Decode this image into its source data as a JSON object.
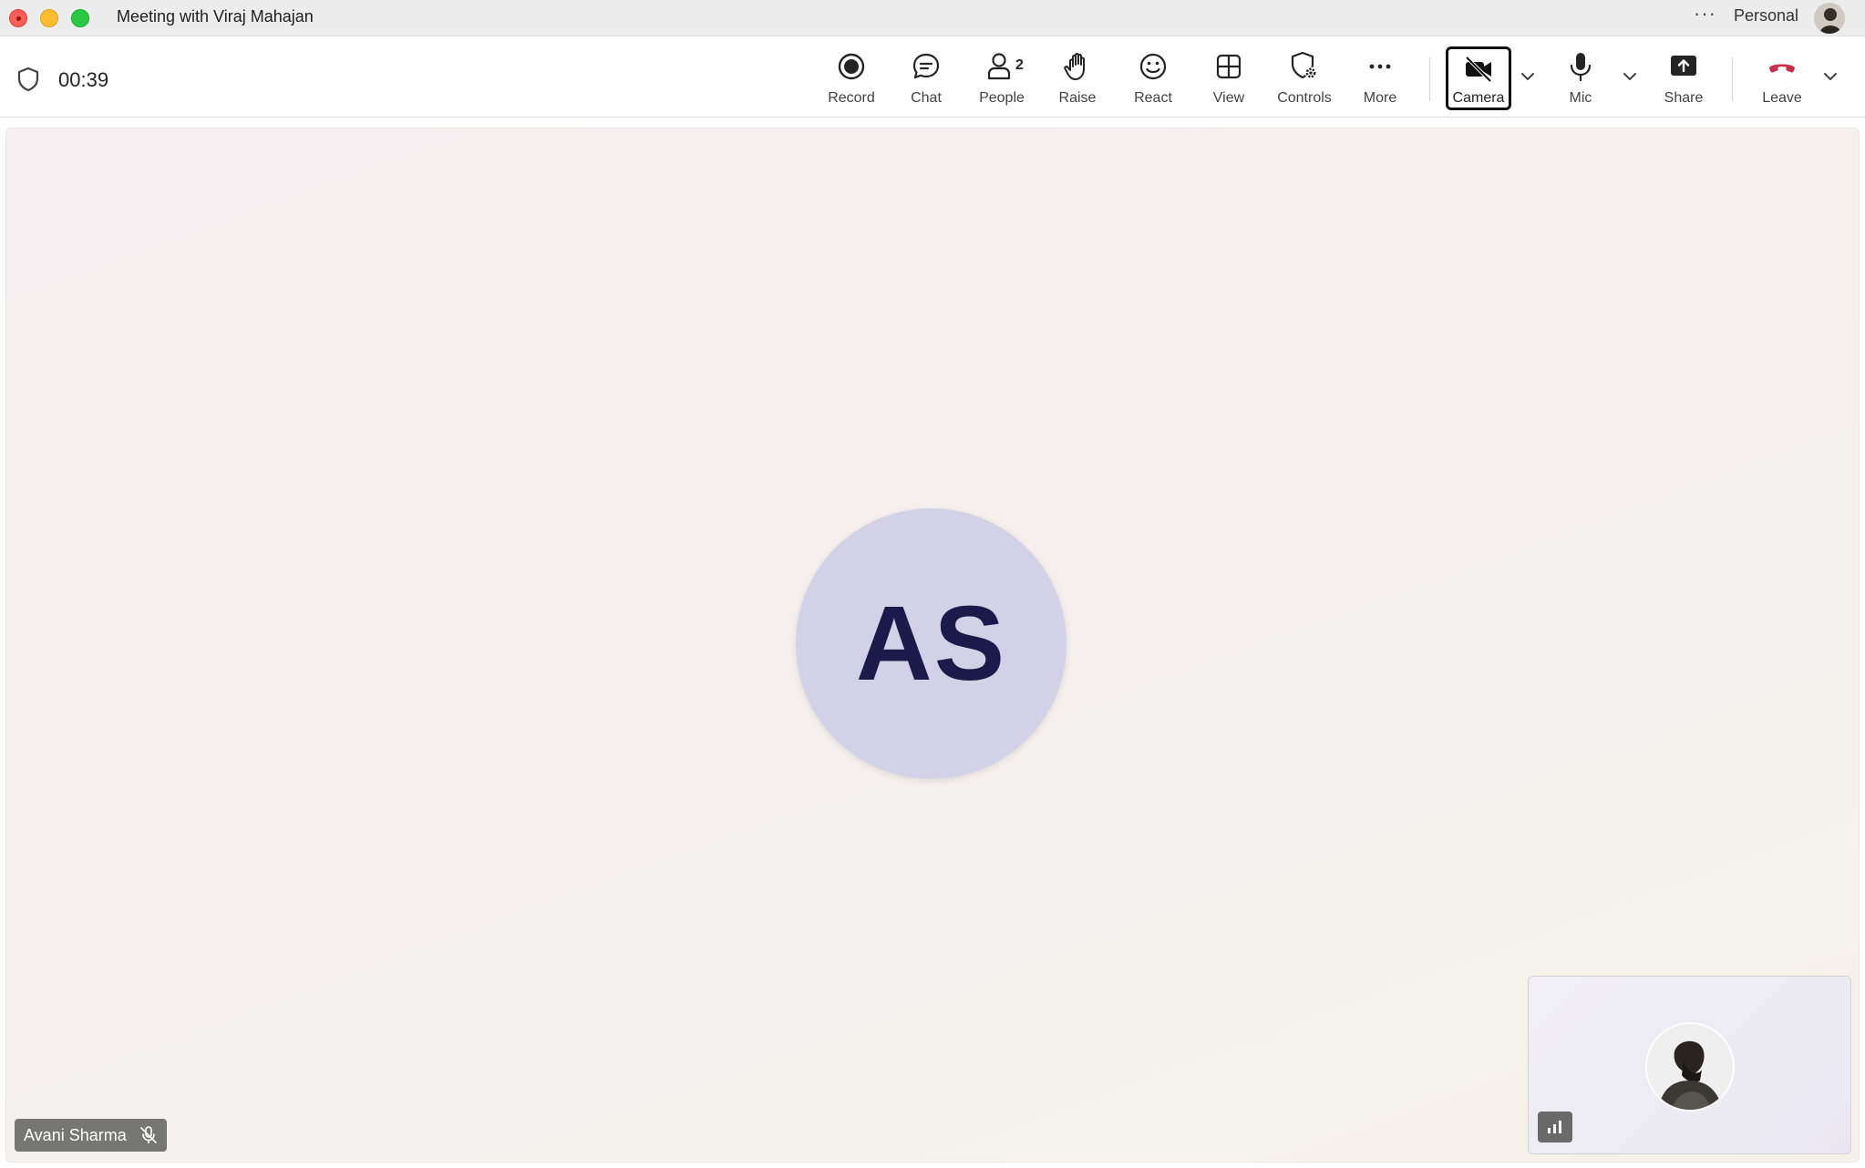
{
  "window": {
    "title": "Meeting with Viraj Mahajan",
    "more_label": "···",
    "account_label": "Personal"
  },
  "toolbar": {
    "timer": "00:39",
    "people_count": "2",
    "buttons": [
      {
        "id": "record",
        "label": "Record",
        "icon": "record-icon"
      },
      {
        "id": "chat",
        "label": "Chat",
        "icon": "chat-icon"
      },
      {
        "id": "people",
        "label": "People",
        "icon": "people-icon"
      },
      {
        "id": "raise",
        "label": "Raise",
        "icon": "raise-hand-icon"
      },
      {
        "id": "react",
        "label": "React",
        "icon": "smiley-icon"
      },
      {
        "id": "view",
        "label": "View",
        "icon": "grid-icon"
      },
      {
        "id": "controls",
        "label": "Controls",
        "icon": "shield-gear-icon"
      },
      {
        "id": "more",
        "label": "More",
        "icon": "more-icon"
      },
      {
        "id": "camera",
        "label": "Camera",
        "icon": "camera-off-icon"
      },
      {
        "id": "mic",
        "label": "Mic",
        "icon": "mic-icon"
      },
      {
        "id": "share",
        "label": "Share",
        "icon": "share-icon"
      },
      {
        "id": "leave",
        "label": "Leave",
        "icon": "hang-up-icon"
      }
    ]
  },
  "stage": {
    "participant_initials": "AS",
    "participant_name": "Avani Sharma",
    "participant_muted": true
  },
  "colors": {
    "accent_leave": "#c4314b",
    "avatar_bg": "#d2d1e6",
    "avatar_text": "#1c1a4a"
  }
}
